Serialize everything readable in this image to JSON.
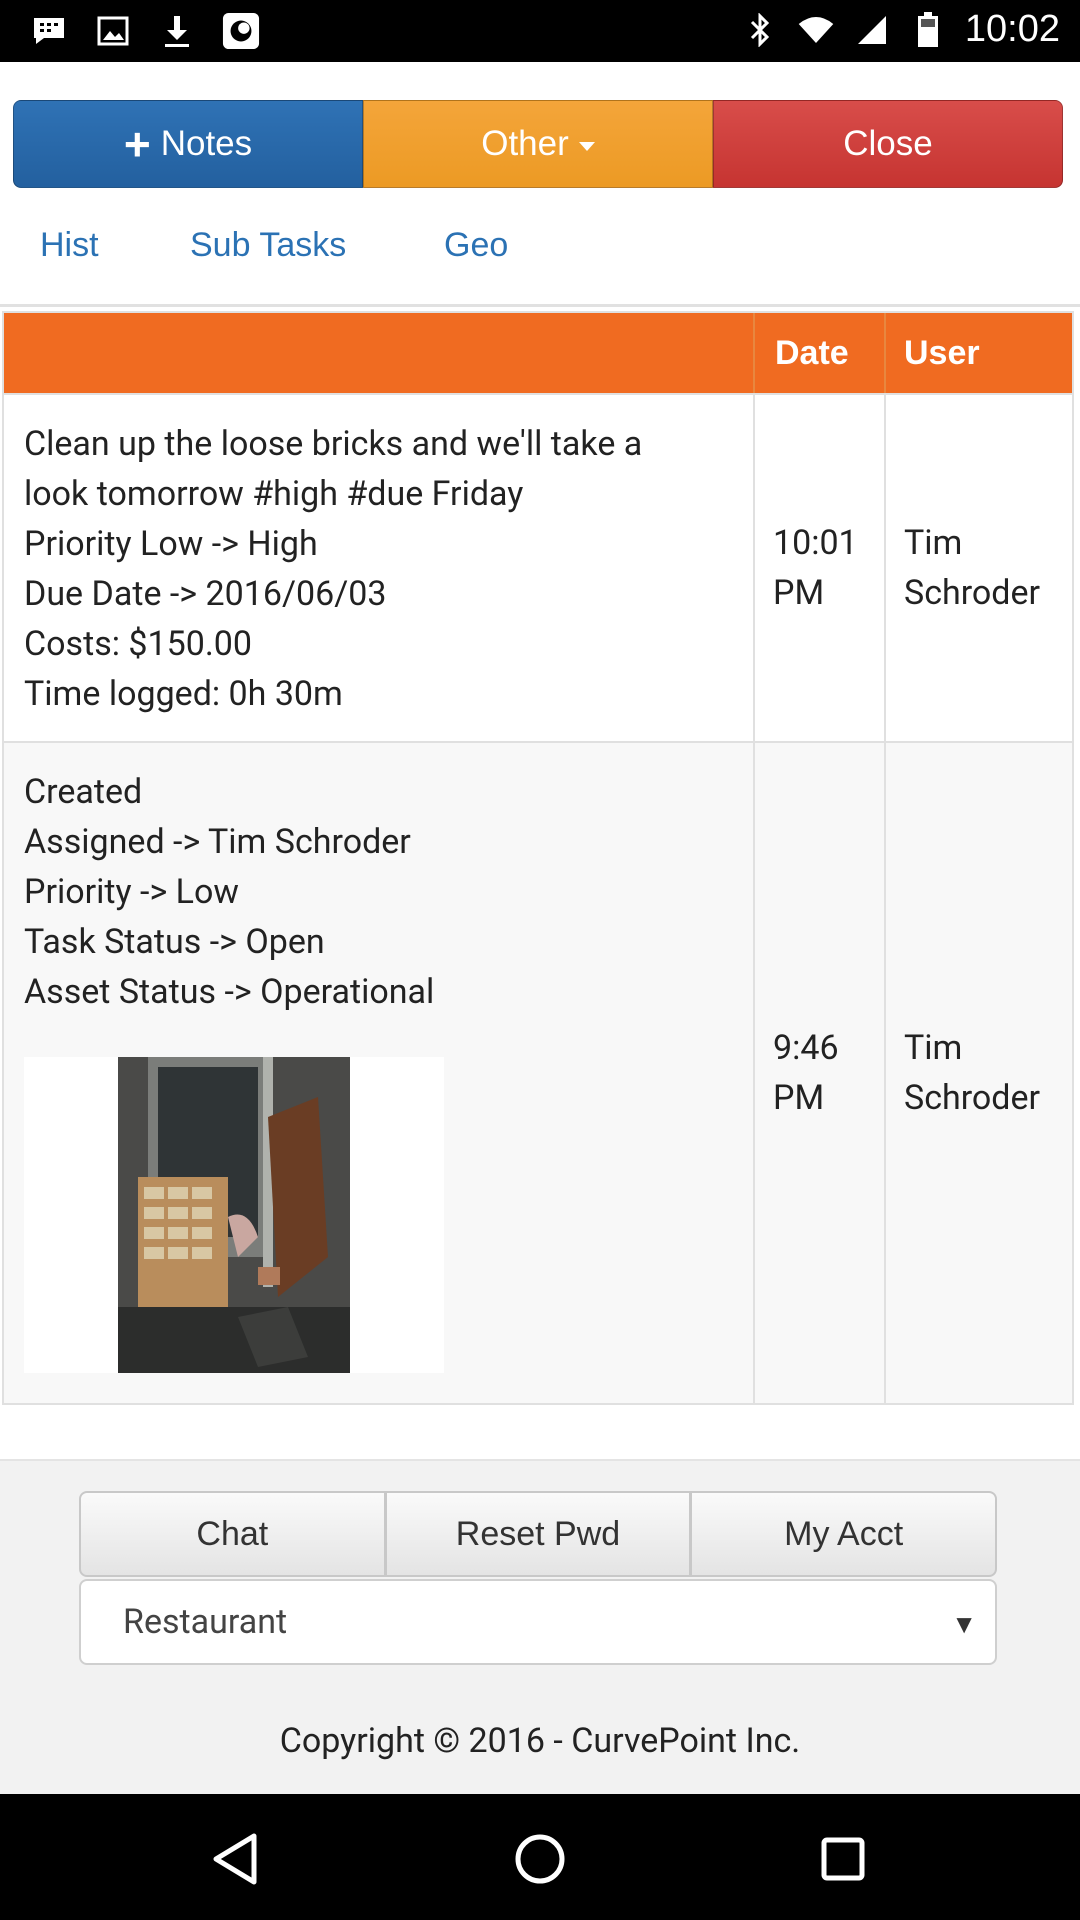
{
  "status_bar": {
    "time": "10:02",
    "left_icons": [
      "bbm-icon",
      "image-icon",
      "download-icon",
      "app-icon"
    ],
    "right_icons": [
      "bluetooth-icon",
      "wifi-icon",
      "signal-icon",
      "battery-icon"
    ]
  },
  "actions": {
    "notes_label": "Notes",
    "other_label": "Other",
    "close_label": "Close",
    "colors": {
      "notes": "#2a6aad",
      "other": "#f0a030",
      "close": "#d04340"
    }
  },
  "tabs": [
    "Hist",
    "Sub Tasks",
    "Geo"
  ],
  "table": {
    "header_color": "#f06b21",
    "columns": [
      "",
      "Date",
      "User"
    ],
    "rows": [
      {
        "lines": [
          "Clean up the loose bricks and we'll take a",
          "look tomorrow #high #due Friday",
          "Priority Low -> High",
          "Due Date -> 2016/06/03",
          "Costs: $150.00",
          "Time logged: 0h 30m"
        ],
        "date": [
          "10:01",
          "PM"
        ],
        "user": [
          "Tim",
          "Schroder"
        ]
      },
      {
        "lines": [
          "Created",
          "Assigned -> Tim Schroder",
          "Priority -> Low",
          "Task Status -> Open",
          "Asset Status -> Operational"
        ],
        "date": [
          "9:46",
          "PM"
        ],
        "user": [
          "Tim",
          "Schroder"
        ]
      }
    ]
  },
  "footer": {
    "buttons": [
      "Chat",
      "Reset Pwd",
      "My Acct"
    ],
    "select_value": "Restaurant",
    "copyright": "Copyright © 2016 - CurvePoint Inc."
  }
}
